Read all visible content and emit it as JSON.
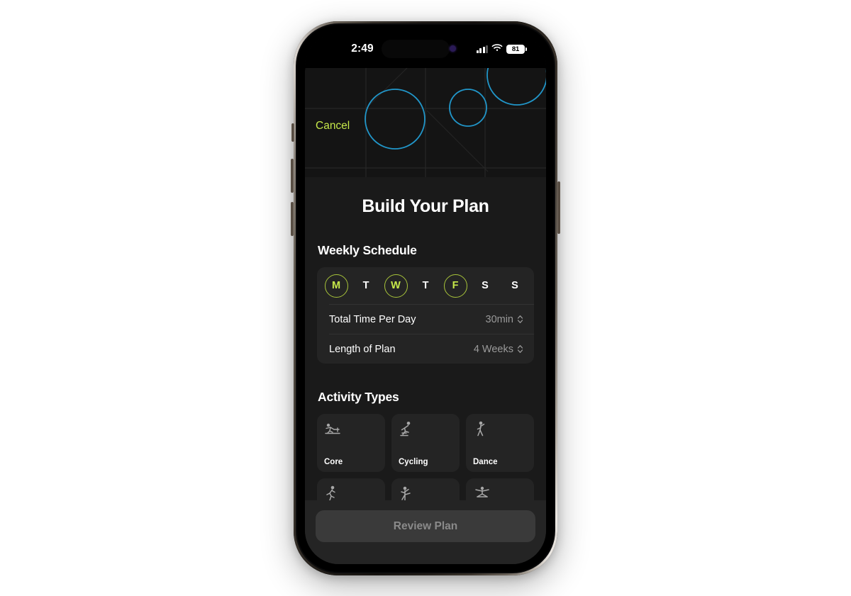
{
  "status_bar": {
    "time": "2:49",
    "signal_icon": "cellular-signal-icon",
    "wifi_icon": "wifi-icon",
    "battery_level": "81",
    "battery_icon": "battery-icon",
    "island_indicator_icon": "recording-indicator-icon"
  },
  "hero": {
    "cancel_label": "Cancel",
    "decor_icon": "abstract-circles-graphic",
    "accent_color": "#2196c9"
  },
  "main": {
    "title": "Build Your Plan"
  },
  "schedule": {
    "section_title": "Weekly Schedule",
    "days": [
      {
        "label": "M",
        "name": "monday",
        "selected": true
      },
      {
        "label": "T",
        "name": "tuesday",
        "selected": false
      },
      {
        "label": "W",
        "name": "wednesday",
        "selected": true
      },
      {
        "label": "T",
        "name": "thursday",
        "selected": false
      },
      {
        "label": "F",
        "name": "friday",
        "selected": true
      },
      {
        "label": "S",
        "name": "saturday",
        "selected": false
      },
      {
        "label": "S",
        "name": "sunday",
        "selected": false
      }
    ],
    "options": [
      {
        "label": "Total Time Per Day",
        "value": "30min",
        "stepper_icon": "chevron-up-down-icon"
      },
      {
        "label": "Length of Plan",
        "value": "4 Weeks",
        "stepper_icon": "chevron-up-down-icon"
      }
    ]
  },
  "activities": {
    "section_title": "Activity Types",
    "cards": [
      {
        "label": "Core",
        "icon": "core-workout-icon"
      },
      {
        "label": "Cycling",
        "icon": "cycling-icon"
      },
      {
        "label": "Dance",
        "icon": "dance-icon"
      },
      {
        "label": "",
        "icon": "running-icon"
      },
      {
        "label": "",
        "icon": "kickboxing-icon"
      },
      {
        "label": "",
        "icon": "yoga-icon"
      }
    ]
  },
  "footer": {
    "review_label": "Review Plan",
    "home_indicator": "home-indicator"
  },
  "colors": {
    "accent_lime": "#c6e84a",
    "accent_cyan": "#2196c9",
    "sheet_bg": "#1a1a1a",
    "card_bg": "#242424"
  }
}
